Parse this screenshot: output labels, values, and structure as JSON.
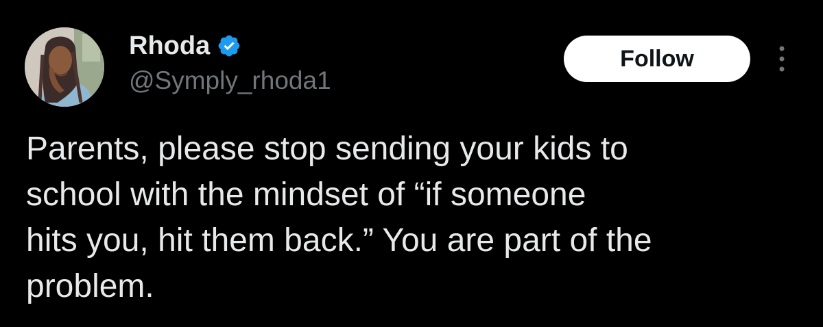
{
  "user": {
    "display_name": "Rhoda",
    "handle": "@Symply_rhoda1",
    "verified": true,
    "avatar_icon": "profile-photo"
  },
  "actions": {
    "follow_label": "Follow",
    "more_icon": "more-vertical-icon"
  },
  "tweet": {
    "text": "Parents, please stop sending your kids to\nschool with the mindset of “if someone\nhits you, hit them back.” You are part of the\nproblem."
  },
  "colors": {
    "background": "#000000",
    "text_primary": "#e7e9ea",
    "text_secondary": "#71767b",
    "verified_blue": "#1d9bf0",
    "follow_bg": "#ffffff",
    "follow_text": "#0f1419"
  }
}
